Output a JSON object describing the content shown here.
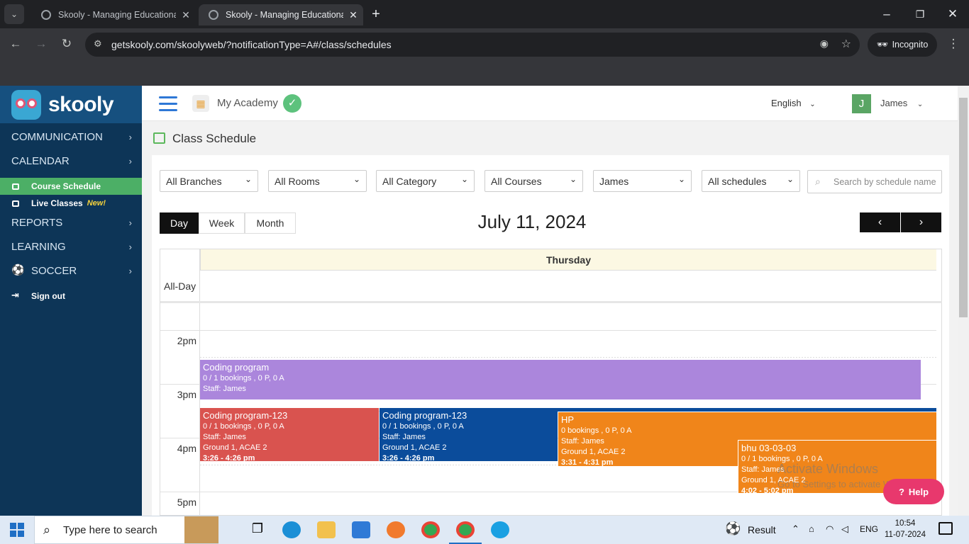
{
  "browser": {
    "tabs": [
      {
        "title": "Skooly - Managing Educational",
        "active": false
      },
      {
        "title": "Skooly - Managing Educational",
        "active": true
      }
    ],
    "url": "getskooly.com/skoolyweb/?notificationType=A#/class/schedules",
    "profile": "Incognito"
  },
  "sidebar": {
    "logo": "skooly",
    "items": [
      {
        "label": "COMMUNICATION"
      },
      {
        "label": "CALENDAR"
      },
      {
        "label": "Course Schedule",
        "active": true
      },
      {
        "label": "Live Classes",
        "badge": "New!"
      },
      {
        "label": "REPORTS"
      },
      {
        "label": "LEARNING"
      },
      {
        "label": "SOCCER"
      },
      {
        "label": "Sign out"
      }
    ]
  },
  "header": {
    "academy": "My Academy",
    "language": "English",
    "user_initial": "J",
    "user_name": "James"
  },
  "page": {
    "title": "Class Schedule",
    "filters": [
      "All Branches",
      "All Rooms",
      "All Category",
      "All Courses",
      "James",
      "All schedules"
    ],
    "search_placeholder": "Search by schedule name",
    "views": [
      "Day",
      "Week",
      "Month"
    ],
    "active_view": "Day",
    "date": "July 11, 2024",
    "day_name": "Thursday",
    "allday_label": "All-Day",
    "time_labels": [
      "2pm",
      "3pm",
      "4pm",
      "5pm"
    ]
  },
  "events": [
    {
      "title": "Coding program",
      "line1": "0 / 1 bookings , 0 P, 0 A",
      "line2": "Staff: James",
      "line3": "",
      "time": "",
      "color": "#ab86dc"
    },
    {
      "title": "Coding program-123",
      "line1": "0 / 1 bookings , 0 P, 0 A",
      "line2": "Staff: James",
      "line3": "Ground 1, ACAE 2",
      "time": "3:26 - 4:26 pm",
      "color": "#d9534f"
    },
    {
      "title": "Coding program-123",
      "line1": "0 / 1 bookings , 0 P, 0 A",
      "line2": "Staff: James",
      "line3": "Ground 1, ACAE 2",
      "time": "3:26 - 4:26 pm",
      "color": "#0b4c9b"
    },
    {
      "title": "HP",
      "line1": "0 bookings , 0 P, 0 A",
      "line2": "Staff: James",
      "line3": "Ground 1, ACAE 2",
      "time": "3:31 - 4:31 pm",
      "color": "#f0851a"
    },
    {
      "title": "bhu 03-03-03",
      "line1": "0 / 1 bookings , 0 P, 0 A",
      "line2": "Staff: James",
      "line3": "Ground 1, ACAE 2",
      "time": "4:02 - 5:02 pm",
      "color": "#f0851a"
    }
  ],
  "help_label": "Help",
  "watermark": {
    "line1": "Activate Windows",
    "line2": "Go to Settings to activate Windows."
  },
  "taskbar": {
    "search": "Type here to search",
    "weather": "Result",
    "lang": "ENG",
    "time": "10:54",
    "date": "11-07-2024"
  }
}
